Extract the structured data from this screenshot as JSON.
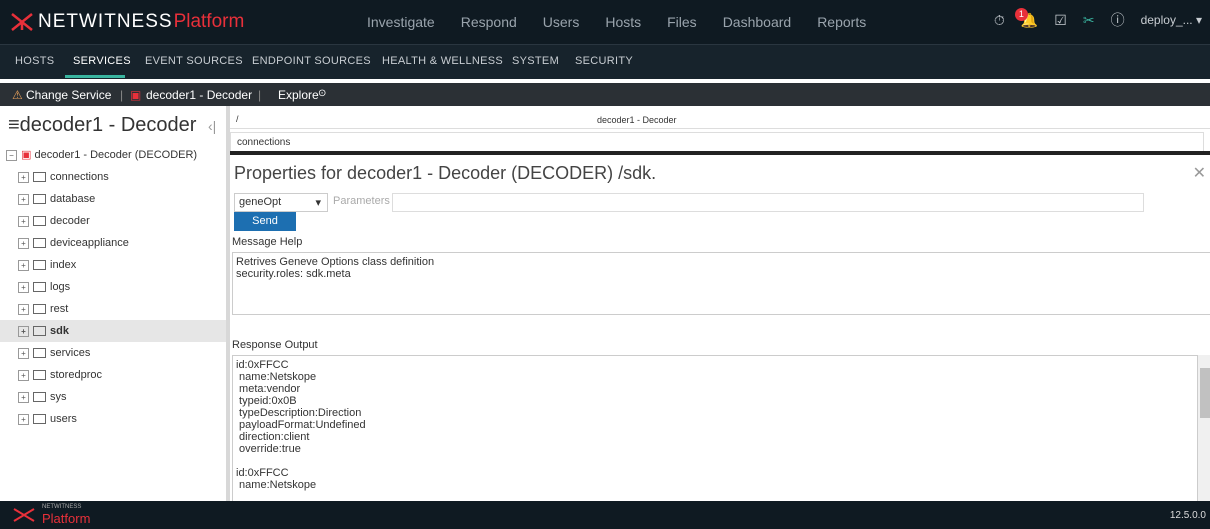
{
  "app": {
    "brand": "NETWITNESS",
    "platform": "Platform"
  },
  "main_nav": [
    "Investigate",
    "Respond",
    "Users",
    "Hosts",
    "Files",
    "Dashboard",
    "Reports"
  ],
  "top_right": {
    "notification_count": "1",
    "user": "deploy_..."
  },
  "sub_nav": [
    "HOSTS",
    "SERVICES",
    "EVENT SOURCES",
    "ENDPOINT SOURCES",
    "HEALTH & WELLNESS",
    "SYSTEM",
    "SECURITY"
  ],
  "toolbar": {
    "change_service": "Change Service",
    "service": "decoder1 - Decoder",
    "explore": "Explore"
  },
  "left": {
    "title": "decoder1 - Decoder",
    "root": "decoder1 - Decoder (DECODER)",
    "items": [
      "connections",
      "database",
      "decoder",
      "deviceappliance",
      "index",
      "logs",
      "rest",
      "sdk",
      "services",
      "storedproc",
      "sys",
      "users"
    ],
    "selected": "sdk"
  },
  "path": {
    "slash": "/",
    "service": "decoder1 - Decoder",
    "connections": "connections"
  },
  "properties": {
    "title": "Properties for decoder1 - Decoder (DECODER) /sdk.",
    "message": "geneOpt",
    "params_label": "Parameters",
    "send": "Send",
    "help_label": "Message Help",
    "help_lines": [
      "Retrives Geneve Options class definition",
      "security.roles: sdk.meta"
    ],
    "response_label": "Response Output",
    "response_lines": [
      "id:0xFFCC",
      " name:Netskope",
      " meta:vendor",
      " typeid:0x0B",
      " typeDescription:Direction",
      " payloadFormat:Undefined",
      " direction:client",
      " override:true",
      "",
      "id:0xFFCC",
      " name:Netskope"
    ]
  },
  "footer": {
    "brand": "NETWITNESS",
    "platform": "Platform",
    "version": "12.5.0.0"
  },
  "colors": {
    "accent": "#e8303a",
    "teal": "#3ab5a0",
    "send": "#1d6fb1"
  }
}
